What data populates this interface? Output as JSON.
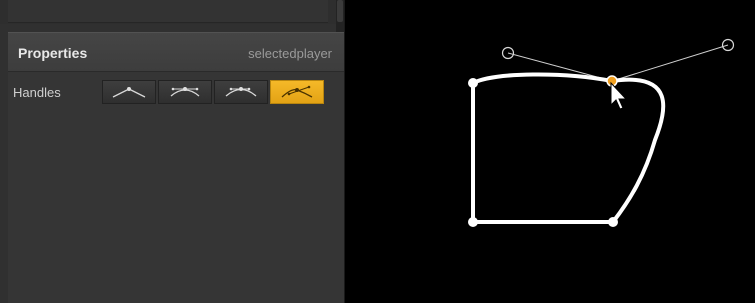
{
  "properties_panel": {
    "title": "Properties",
    "selected_player": "selectedplayer",
    "handles_label": "Handles",
    "handle_buttons": [
      {
        "icon": "handle-smooth-icon",
        "active": false
      },
      {
        "icon": "handle-symmetric-icon",
        "active": false
      },
      {
        "icon": "handle-asymmetric-icon",
        "active": false
      },
      {
        "icon": "handle-broken-icon",
        "active": true
      }
    ]
  },
  "canvas": {
    "shape": "closed-bezier-path",
    "selected_point_color": "#f0a020",
    "stroke_color": "#ffffff",
    "background": "#000000"
  },
  "colors": {
    "panel_bg": "#353535",
    "header_bg": "#424242",
    "accent": "#f0b020"
  }
}
